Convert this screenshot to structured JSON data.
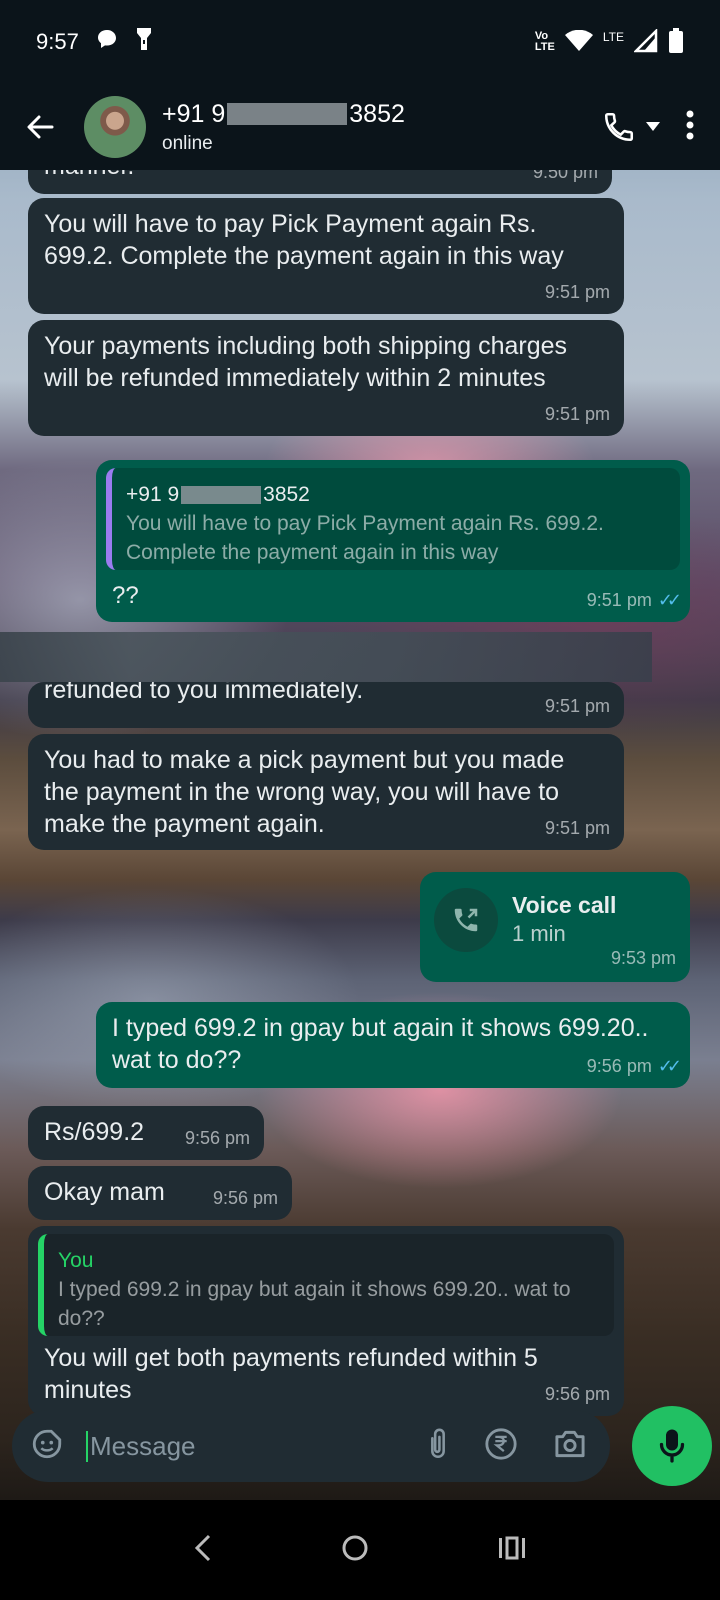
{
  "status_bar": {
    "time": "9:57",
    "network_top": "Vo",
    "network_bottom": "LTE",
    "lte": "LTE"
  },
  "header": {
    "name_prefix": "+91 9",
    "name_suffix": "3852",
    "status": "online"
  },
  "messages": [
    {
      "id": "m0",
      "direction": "incoming",
      "text": "manner.",
      "time": "9:50 pm"
    },
    {
      "id": "m1",
      "direction": "incoming",
      "text": "You will have to pay Pick Payment again Rs. 699.2. Complete the payment again in this way",
      "time": "9:51 pm"
    },
    {
      "id": "m2",
      "direction": "incoming",
      "text": "Your payments including both shipping charges will be refunded immediately within 2 minutes",
      "time": "9:51 pm"
    },
    {
      "id": "m3",
      "direction": "outgoing",
      "quote": {
        "author_prefix": "+91 9",
        "author_suffix": "3852",
        "text": "You will have to pay Pick Payment again Rs. 699.2. Complete the payment again in this way"
      },
      "text": "??",
      "time": "9:51 pm",
      "ticks": "✓✓"
    },
    {
      "id": "m4",
      "direction": "incoming",
      "text": "refunded to you immediately.",
      "time": "9:51 pm"
    },
    {
      "id": "m5",
      "direction": "incoming",
      "text": "You had to make a pick payment but you made the payment in the wrong way, you will have to make the payment again.",
      "time": "9:51 pm"
    },
    {
      "id": "m6",
      "direction": "outgoing",
      "type": "call",
      "title": "Voice call",
      "duration": "1 min",
      "time": "9:53 pm"
    },
    {
      "id": "m7",
      "direction": "outgoing",
      "text": "I typed 699.2 in gpay but again it shows 699.20.. wat to do??",
      "time": "9:56 pm",
      "ticks": "✓✓"
    },
    {
      "id": "m8",
      "direction": "incoming",
      "text": "Rs/699.2",
      "time": "9:56 pm"
    },
    {
      "id": "m9",
      "direction": "incoming",
      "text": "Okay mam",
      "time": "9:56 pm"
    },
    {
      "id": "m10",
      "direction": "incoming",
      "quote": {
        "author": "You",
        "text": "I typed 699.2 in gpay but again it shows 699.20.. wat to do??"
      },
      "text": "You will get both payments refunded within 5 minutes",
      "time": "9:56 pm"
    }
  ],
  "input": {
    "placeholder": "Message"
  },
  "colors": {
    "incoming_bubble": "#202c33",
    "outgoing_bubble": "#005c4b",
    "accent": "#25d366",
    "read_ticks": "#53bdeb"
  }
}
